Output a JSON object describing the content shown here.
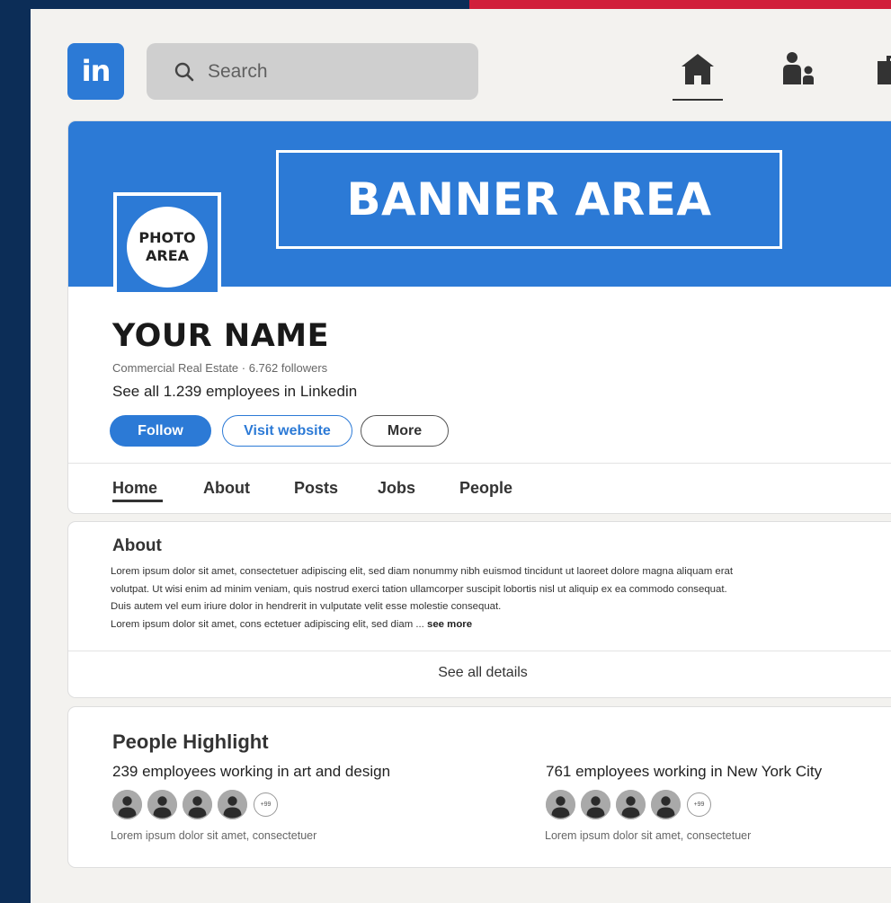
{
  "nav": {
    "logo": "in",
    "search_placeholder": "Search",
    "icons": [
      "home-icon",
      "my-network-icon",
      "jobs-briefcase-icon"
    ],
    "active": "home"
  },
  "profile": {
    "banner_text": "BANNER AREA",
    "photo_text": [
      "PHOTO",
      "AREA"
    ],
    "name": "YOUR NAME",
    "subtitle": "Commercial Real Estate · 6.762 followers",
    "employees_link": "See all 1.239 employees in Linkedin",
    "buttons": {
      "follow": "Follow",
      "visit": "Visit website",
      "more": "More"
    },
    "tabs": [
      "Home",
      "About",
      "Posts",
      "Jobs",
      "People"
    ],
    "active_tab": "Home"
  },
  "about": {
    "title": "About",
    "lines": [
      "Lorem ipsum dolor sit amet, consectetuer adipiscing elit, sed diam nonummy nibh euismod tincidunt ut laoreet dolore magna aliquam erat",
      "volutpat. Ut wisi enim ad minim veniam, quis nostrud exerci tation ullamcorper suscipit lobortis nisl ut aliquip ex ea commodo consequat.",
      "Duis autem vel eum iriure dolor in hendrerit in vulputate velit esse molestie consequat.",
      "Lorem ipsum dolor sit amet, cons ectetuer adipiscing elit, sed diam ..."
    ],
    "see_more": "see more",
    "see_all": "See all details"
  },
  "people_highlight": {
    "title": "People Highlight",
    "groups": [
      {
        "heading": "239 employees working in art and design",
        "more_count": "+99",
        "caption": "Lorem ipsum dolor sit amet, consectetuer"
      },
      {
        "heading": "761 employees working in New York City",
        "more_count": "+99",
        "caption": "Lorem ipsum dolor sit amet, consectetuer"
      }
    ]
  },
  "colors": {
    "accent": "#2c7ad6",
    "outer_background": "#0c2d57",
    "top_strip": "#d11f3a",
    "canvas": "#f3f2ef"
  }
}
